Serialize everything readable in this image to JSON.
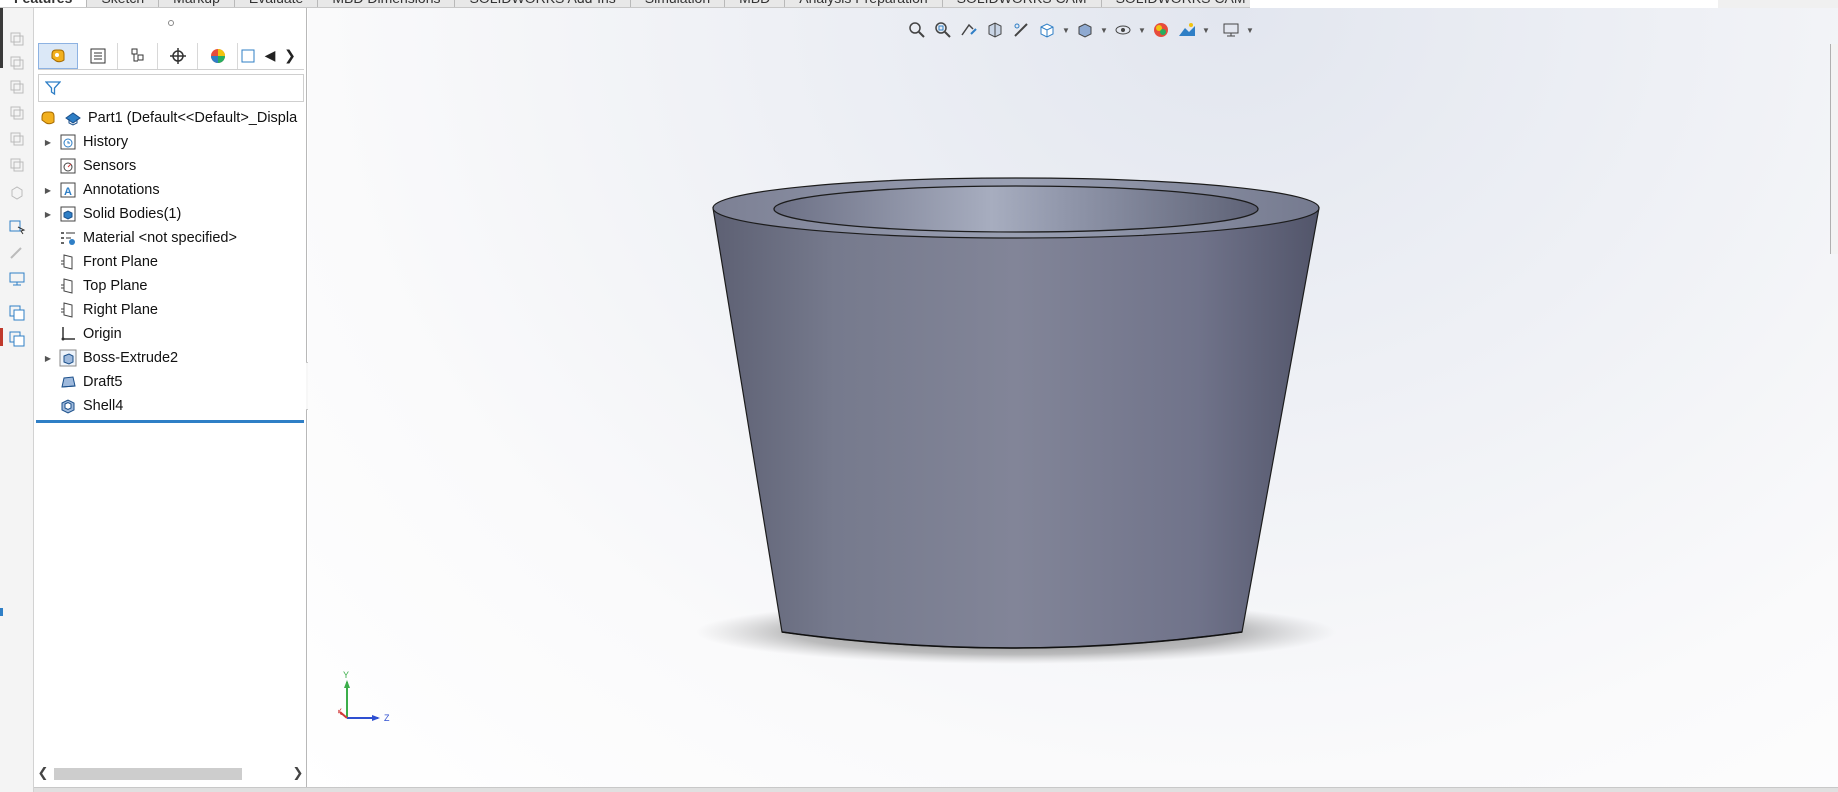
{
  "command_tabs": [
    {
      "label": "Features",
      "active": true
    },
    {
      "label": "Sketch"
    },
    {
      "label": "Markup"
    },
    {
      "label": "Evaluate"
    },
    {
      "label": "MBD Dimensions"
    },
    {
      "label": "SOLIDWORKS Add-Ins"
    },
    {
      "label": "Simulation"
    },
    {
      "label": "MBD"
    },
    {
      "label": "Analysis Preparation"
    },
    {
      "label": "SOLIDWORKS CAM"
    },
    {
      "label": "SOLIDWORKS CAM TBM"
    }
  ],
  "feature_tree": {
    "root": {
      "label": "Part1  (Default<<Default>_Displa",
      "icon": "part-icon"
    },
    "items": [
      {
        "label": "History",
        "icon": "history-icon",
        "expandable": true
      },
      {
        "label": "Sensors",
        "icon": "sensors-icon",
        "expandable": false
      },
      {
        "label": "Annotations",
        "icon": "annotations-icon",
        "expandable": true
      },
      {
        "label": "Solid Bodies(1)",
        "icon": "solid-bodies-icon",
        "expandable": true
      },
      {
        "label": "Material <not specified>",
        "icon": "material-icon",
        "expandable": false
      },
      {
        "label": "Front Plane",
        "icon": "plane-icon",
        "expandable": false
      },
      {
        "label": "Top Plane",
        "icon": "plane-icon",
        "expandable": false
      },
      {
        "label": "Right Plane",
        "icon": "plane-icon",
        "expandable": false
      },
      {
        "label": "Origin",
        "icon": "origin-icon",
        "expandable": false
      },
      {
        "label": "Boss-Extrude2",
        "icon": "extrude-icon",
        "expandable": true
      },
      {
        "label": "Draft5",
        "icon": "draft-icon",
        "expandable": false
      },
      {
        "label": "Shell4",
        "icon": "shell-icon",
        "expandable": false
      }
    ]
  },
  "fm_tabs": [
    "feature-manager-tab-icon",
    "property-manager-tab-icon",
    "configuration-manager-tab-icon",
    "dimxpert-tab-icon",
    "display-manager-tab-icon",
    "cam-tab-icon"
  ],
  "triad": {
    "x": "X",
    "y": "Y",
    "z": "Z"
  },
  "colors": {
    "accent": "#2f7fc6",
    "model_body": "#7b7f92",
    "selection": "#dbe8f7"
  }
}
